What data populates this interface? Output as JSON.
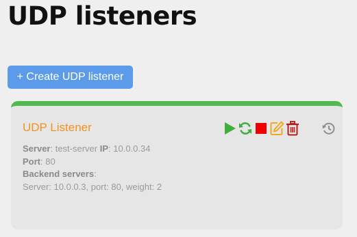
{
  "page": {
    "title": "UDP listeners"
  },
  "toolbar": {
    "create_label": "+ Create UDP listener"
  },
  "listener": {
    "name": "UDP Listener",
    "server_label": "Server",
    "server_value": ": test-server ",
    "ip_label": "IP",
    "ip_value": ": 10.0.0.34",
    "port_label": "Port",
    "port_value": ": 80",
    "backends_label": "Backend servers",
    "backends_suffix": ":",
    "backends": [
      "Server: 10.0.0.3, port: 80, weight: 2"
    ]
  },
  "icons": {
    "start": "play-icon",
    "restart": "refresh-icon",
    "stop": "stop-icon",
    "edit": "edit-icon",
    "delete": "trash-icon",
    "history": "history-icon"
  },
  "colors": {
    "status_active": "#51b94d",
    "accent": "#5b9bea",
    "listener_name": "#f0921e",
    "start": "#3fae3f",
    "stop": "#ee0000",
    "edit": "#f0a91e",
    "delete": "#b81b1b",
    "history": "#8e8e8e"
  }
}
